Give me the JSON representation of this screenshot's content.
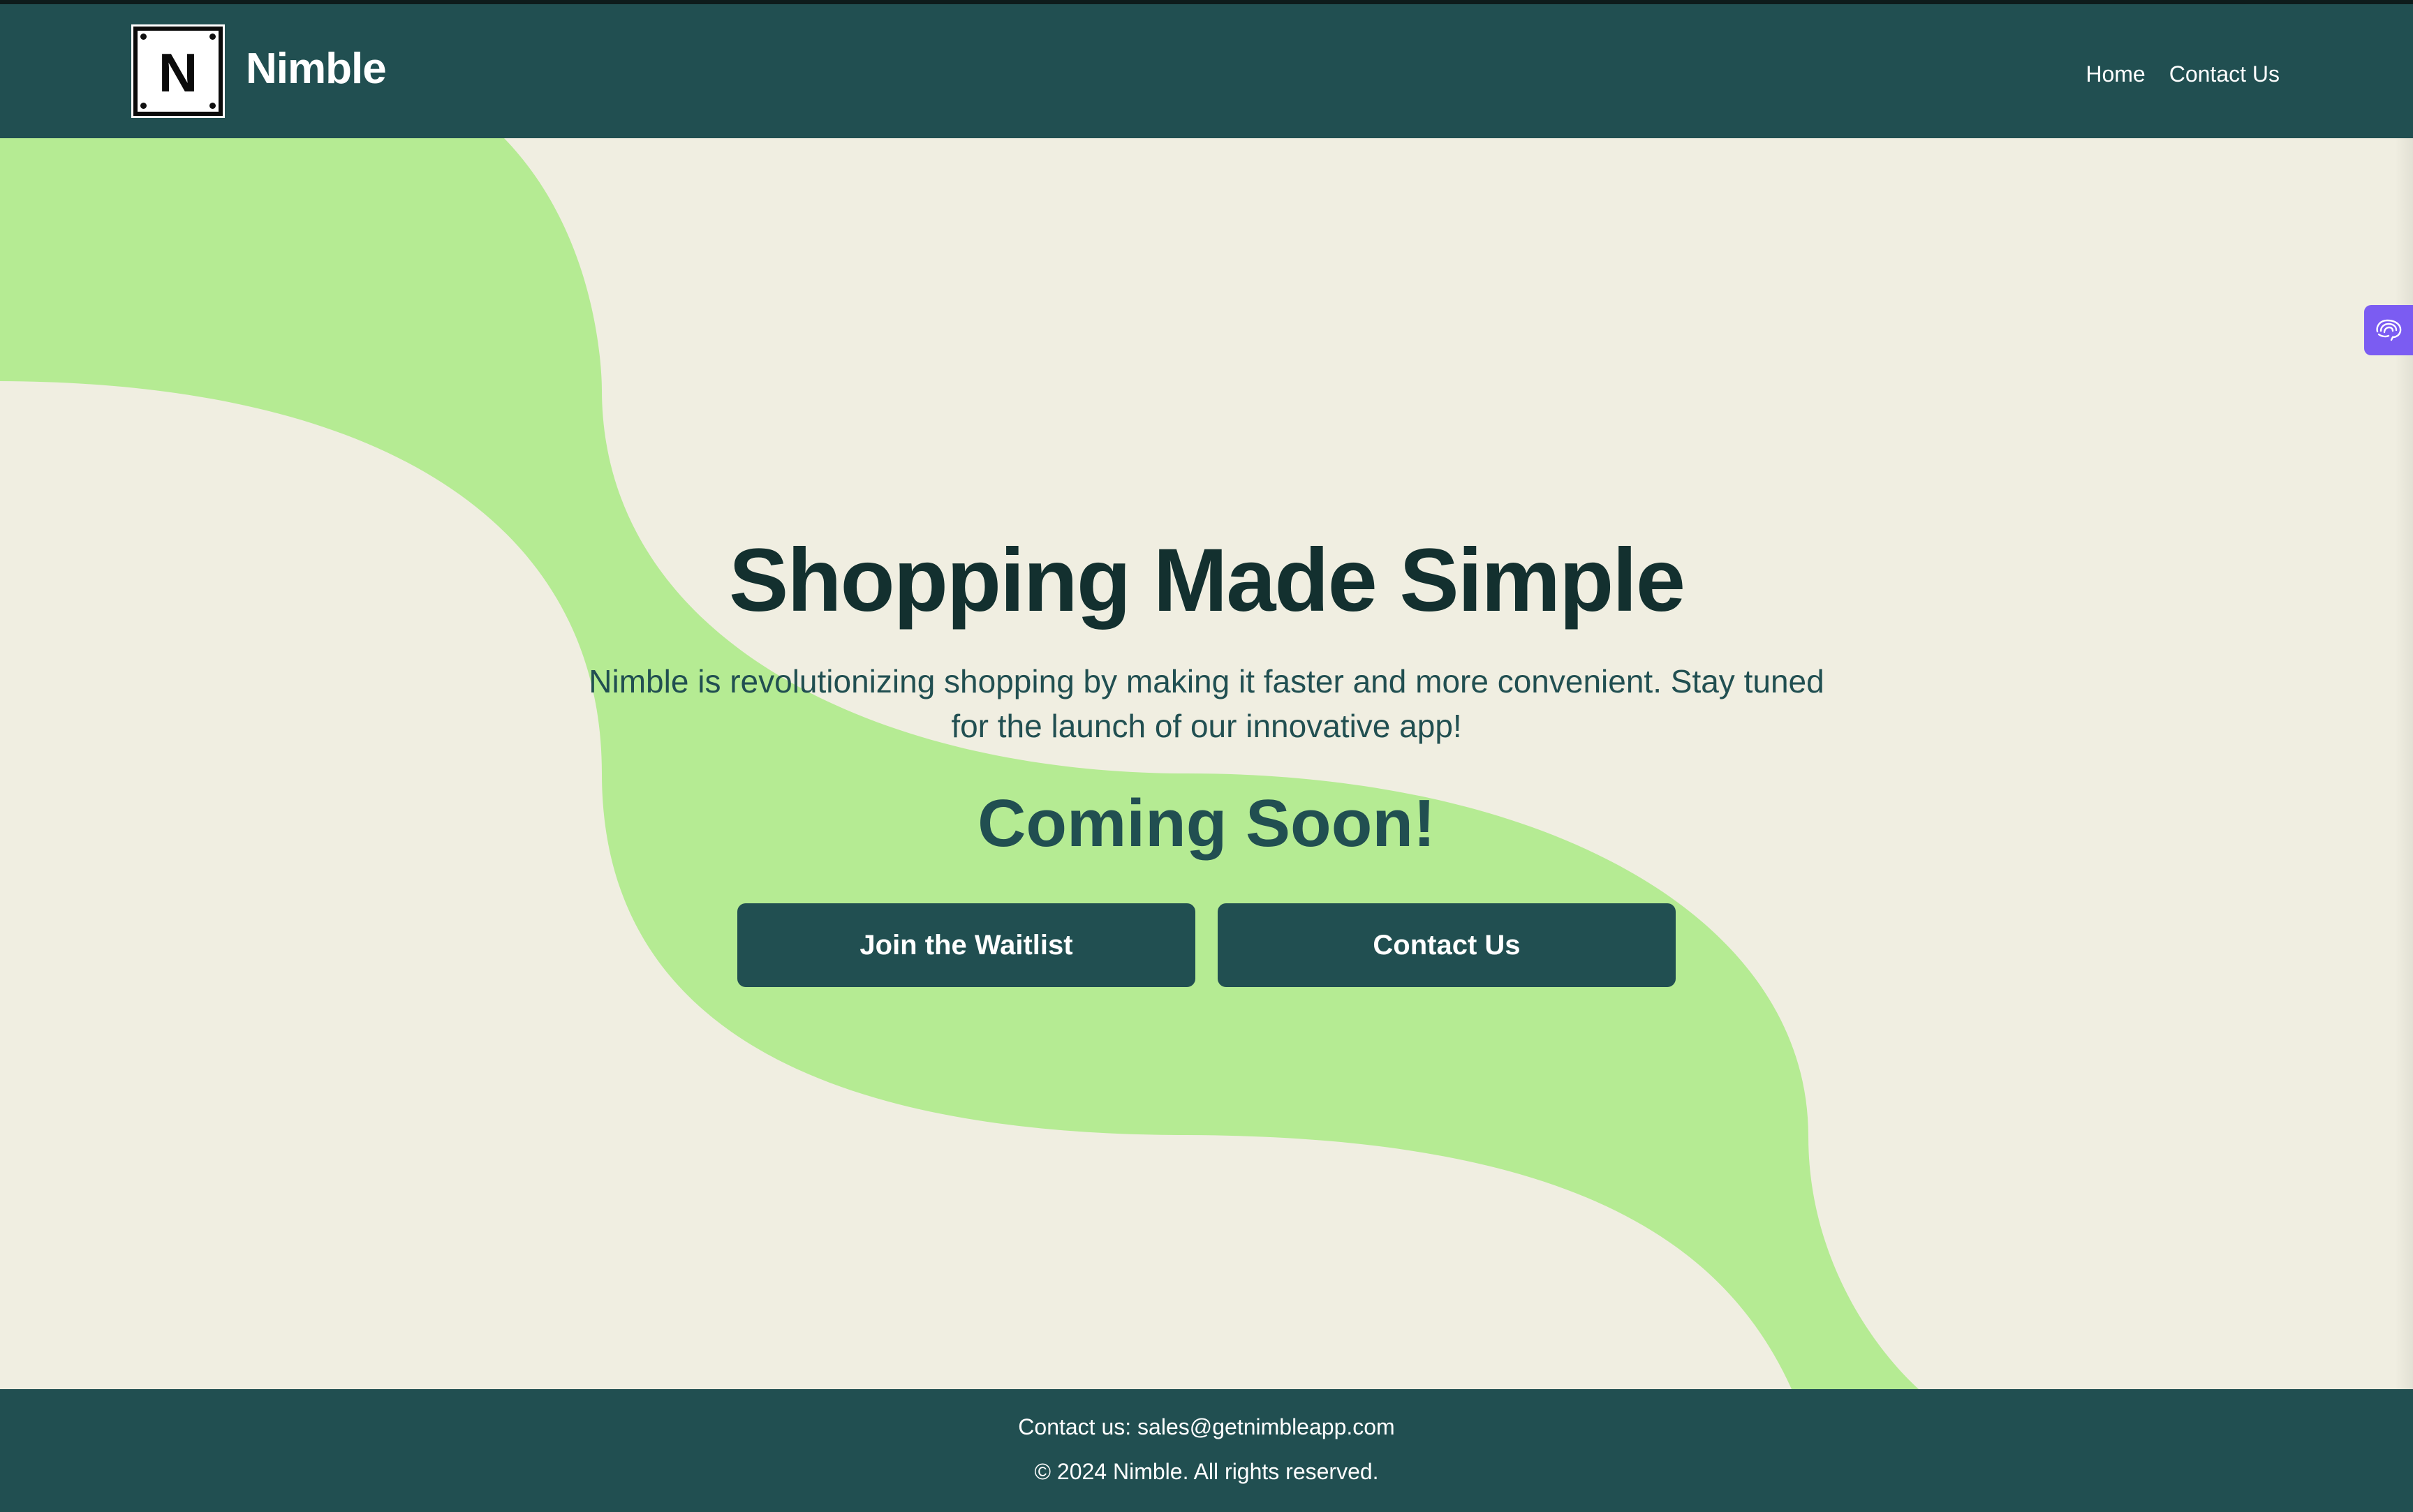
{
  "header": {
    "logo_letter": "N",
    "brand_name": "Nimble",
    "nav": [
      {
        "label": "Home"
      },
      {
        "label": "Contact Us"
      }
    ]
  },
  "hero": {
    "title": "Shopping Made Simple",
    "description": "Nimble is revolutionizing shopping by making it faster and more convenient. Stay tuned for the launch of our innovative app!",
    "subtitle": "Coming Soon!",
    "buttons": {
      "waitlist_label": "Join the Waitlist",
      "contact_label": "Contact Us"
    }
  },
  "footer": {
    "contact_line": "Contact us: sales@getnimbleapp.com",
    "copyright": "© 2024 Nimble. All rights reserved."
  },
  "side_widget": {
    "icon": "brain-icon"
  },
  "colors": {
    "header_bg": "#214f51",
    "page_bg": "#f0eee1",
    "wave": "#b5eb93",
    "heading": "#13302f",
    "accent": "#214f51",
    "widget": "#7b5cf2"
  }
}
